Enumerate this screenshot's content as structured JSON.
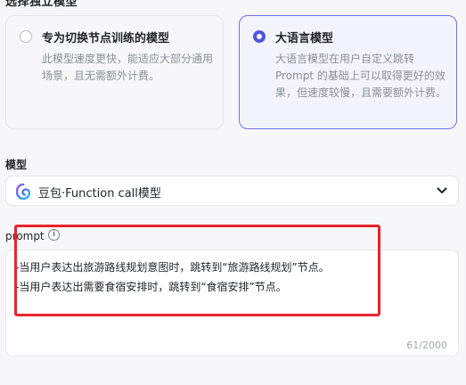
{
  "section": {
    "title": "选择独立模型"
  },
  "options": [
    {
      "title": "专为切换节点训练的模型",
      "desc": "此模型速度更快，能适应大部分通用场景，且无需额外计费。",
      "selected": false
    },
    {
      "title": "大语言模型",
      "desc": "大语言模型在用户自定义跳转 Prompt 的基础上可以取得更好的效果，但速度较慢，且需要额外计费。",
      "selected": true
    }
  ],
  "model": {
    "label": "模型",
    "value": "豆包·Function call模型"
  },
  "prompt": {
    "label": "prompt",
    "lines": [
      "-当用户表达出旅游路线规划意图时，跳转到“旅游路线规划”节点。",
      "-当用户表达出需要食宿安排时，跳转到“食宿安排”节点。"
    ],
    "counter": "61/2000"
  },
  "colors": {
    "accent": "#4e56dd",
    "highlight": "#e8242e"
  }
}
